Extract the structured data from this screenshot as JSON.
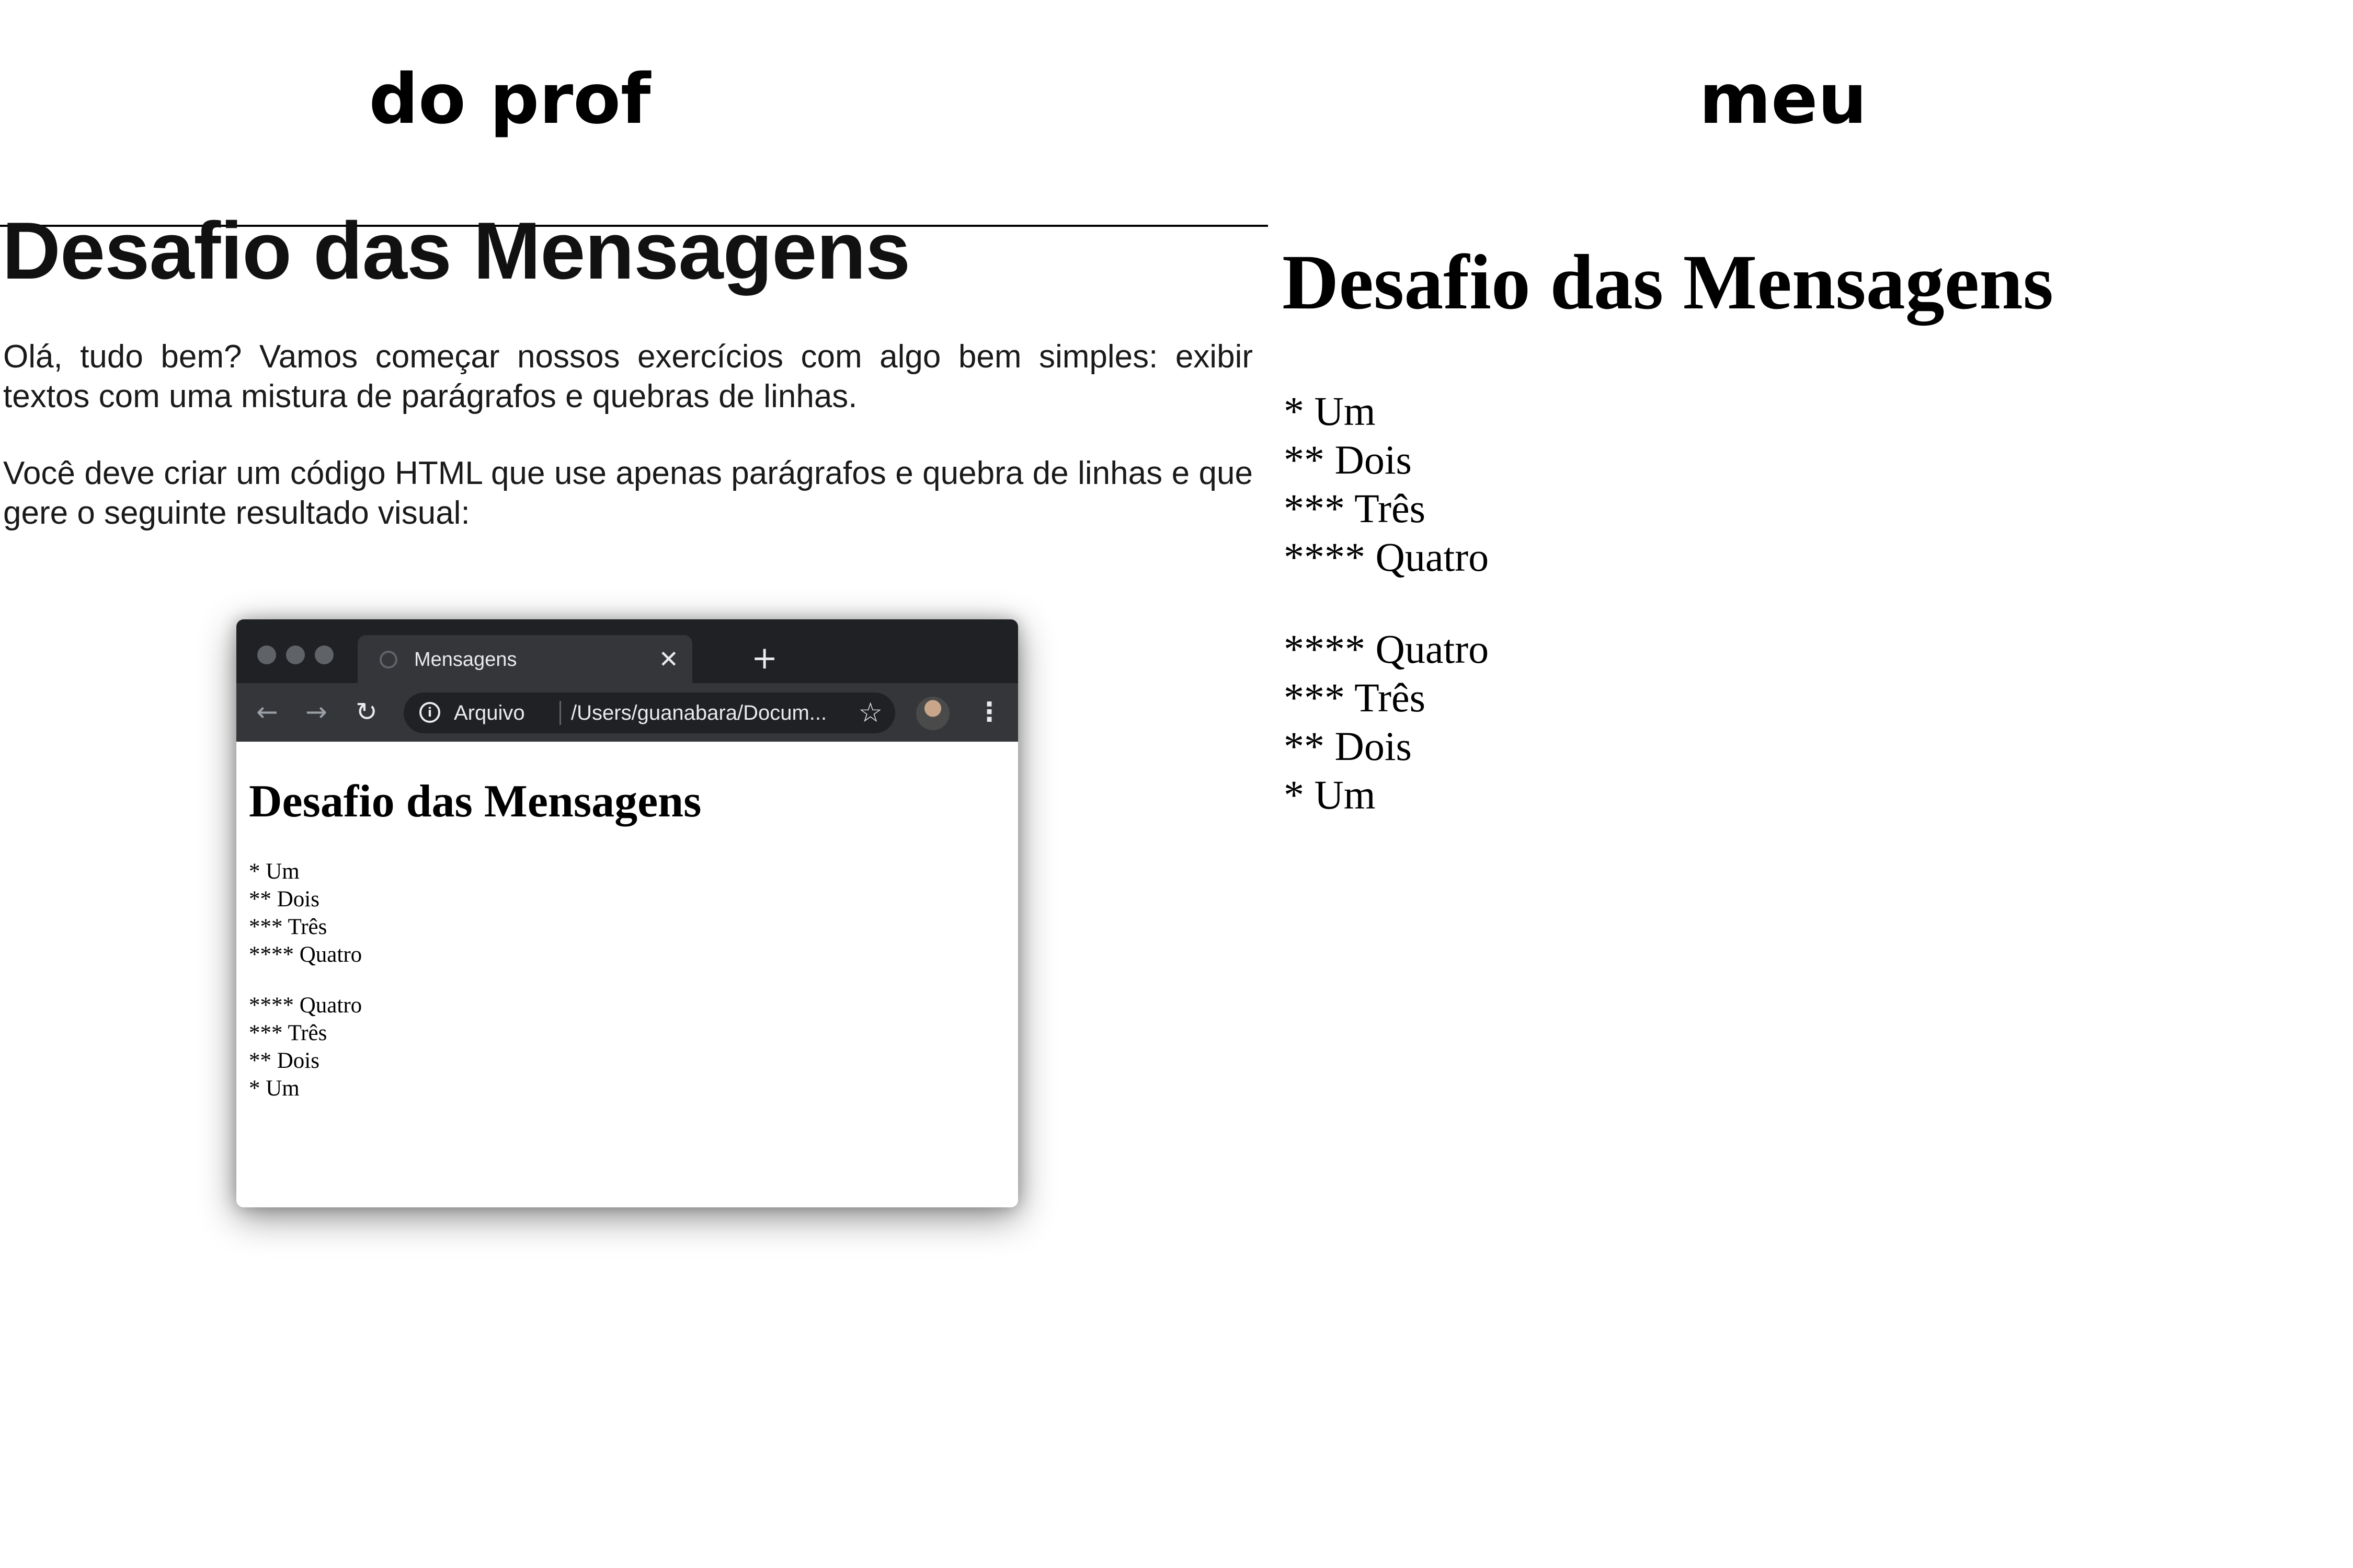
{
  "headers": {
    "left": "do prof",
    "right": "meu"
  },
  "prof_doc": {
    "title": "Desafio das Mensagens",
    "paragraphs": [
      "Olá, tudo bem? Vamos começar nossos exercícios com algo bem simples: exibir textos com uma mistura de parágrafos e quebras de linhas.",
      "Você deve criar um código HTML que use apenas parágrafos e quebra de linhas e que gere o seguinte resultado visual:"
    ],
    "browser": {
      "tab_title": "Mensagens",
      "address_scheme": "Arquivo",
      "address_url": "/Users/guanabara/Docum...",
      "page_title": "Desafio das Mensagens",
      "block_1": [
        "* Um",
        "** Dois",
        "*** Três",
        "**** Quatro"
      ],
      "block_2": [
        "**** Quatro",
        "*** Três",
        "** Dois",
        "* Um"
      ]
    }
  },
  "mine": {
    "title": "Desafio das Mensagens",
    "block_1": [
      "* Um",
      "** Dois",
      "*** Três",
      "**** Quatro"
    ],
    "block_2": [
      "**** Quatro",
      "*** Três",
      "** Dois",
      "* Um"
    ]
  },
  "icons": {
    "tab_favicon": "globe-icon",
    "tab_close": "close-icon",
    "new_tab": "plus-icon",
    "back": "arrow-left-icon",
    "forward": "arrow-right-icon",
    "reload": "reload-icon",
    "info": "info-icon",
    "bookmark": "star-icon",
    "menu": "kebab-menu-icon"
  },
  "colors": {
    "browser_frame_dark": "#202124",
    "browser_tab": "#35363a",
    "browser_text": "#e8eaed"
  }
}
